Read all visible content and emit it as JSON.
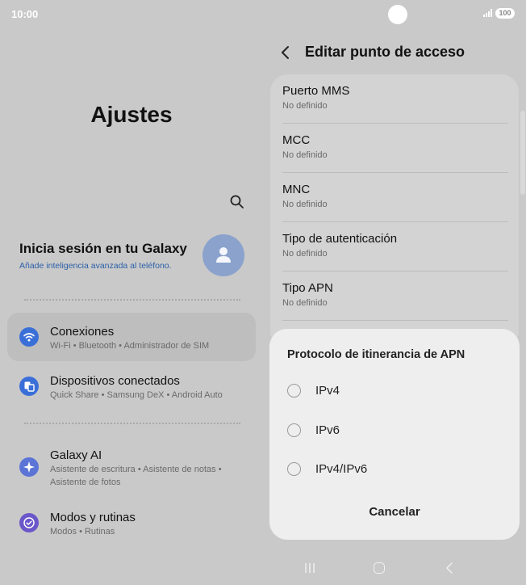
{
  "status_bar": {
    "time": "10:00",
    "battery": "100",
    "icons": [
      "signal-icon",
      "battery-icon",
      "camera-icon"
    ]
  },
  "left": {
    "title": "Ajustes",
    "search_icon": "search-icon",
    "account": {
      "title": "Inicia sesión en tu Galaxy",
      "subtitle": "Añade inteligencia avanzada al teléfono.",
      "avatar_icon": "person-icon"
    },
    "menu": [
      {
        "label": "Conexiones",
        "sub": "Wi-Fi  •  Bluetooth  •  Administrador de SIM",
        "icon": "wifi-icon",
        "color": "#3b6fd8"
      },
      {
        "label": "Dispositivos conectados",
        "sub": "Quick Share  •  Samsung DeX  •  Android Auto",
        "icon": "devices-icon",
        "color": "#3b6fd8"
      },
      {
        "label": "Galaxy AI",
        "sub": "Asistente de escritura  •  Asistente de notas  •  Asistente de fotos",
        "icon": "sparkle-icon",
        "color": "#5b74d6"
      },
      {
        "label": "Modos y rutinas",
        "sub": "Modos  •  Rutinas",
        "icon": "check-circle-icon",
        "color": "#6b57c9"
      }
    ]
  },
  "right": {
    "back_icon": "chevron-left-icon",
    "title": "Editar punto de acceso",
    "fields": [
      {
        "label": "Puerto MMS",
        "value": "No definido"
      },
      {
        "label": "MCC",
        "value": "No definido"
      },
      {
        "label": "MNC",
        "value": "No definido"
      },
      {
        "label": "Tipo de autenticación",
        "value": "No definido"
      },
      {
        "label": "Tipo APN",
        "value": "No definido"
      }
    ]
  },
  "dialog": {
    "title": "Protocolo de itinerancia de APN",
    "options": [
      {
        "label": "IPv4",
        "selected": false
      },
      {
        "label": "IPv6",
        "selected": false
      },
      {
        "label": "IPv4/IPv6",
        "selected": false
      }
    ],
    "cancel": "Cancelar"
  },
  "nav_bar": {
    "icons": [
      "recent-apps-icon",
      "home-icon",
      "back-icon"
    ]
  },
  "colors": {
    "background": "#c9c9c9",
    "dialog": "#eeeeee",
    "card": "#d3d3d3",
    "link": "#2c5fa8"
  }
}
